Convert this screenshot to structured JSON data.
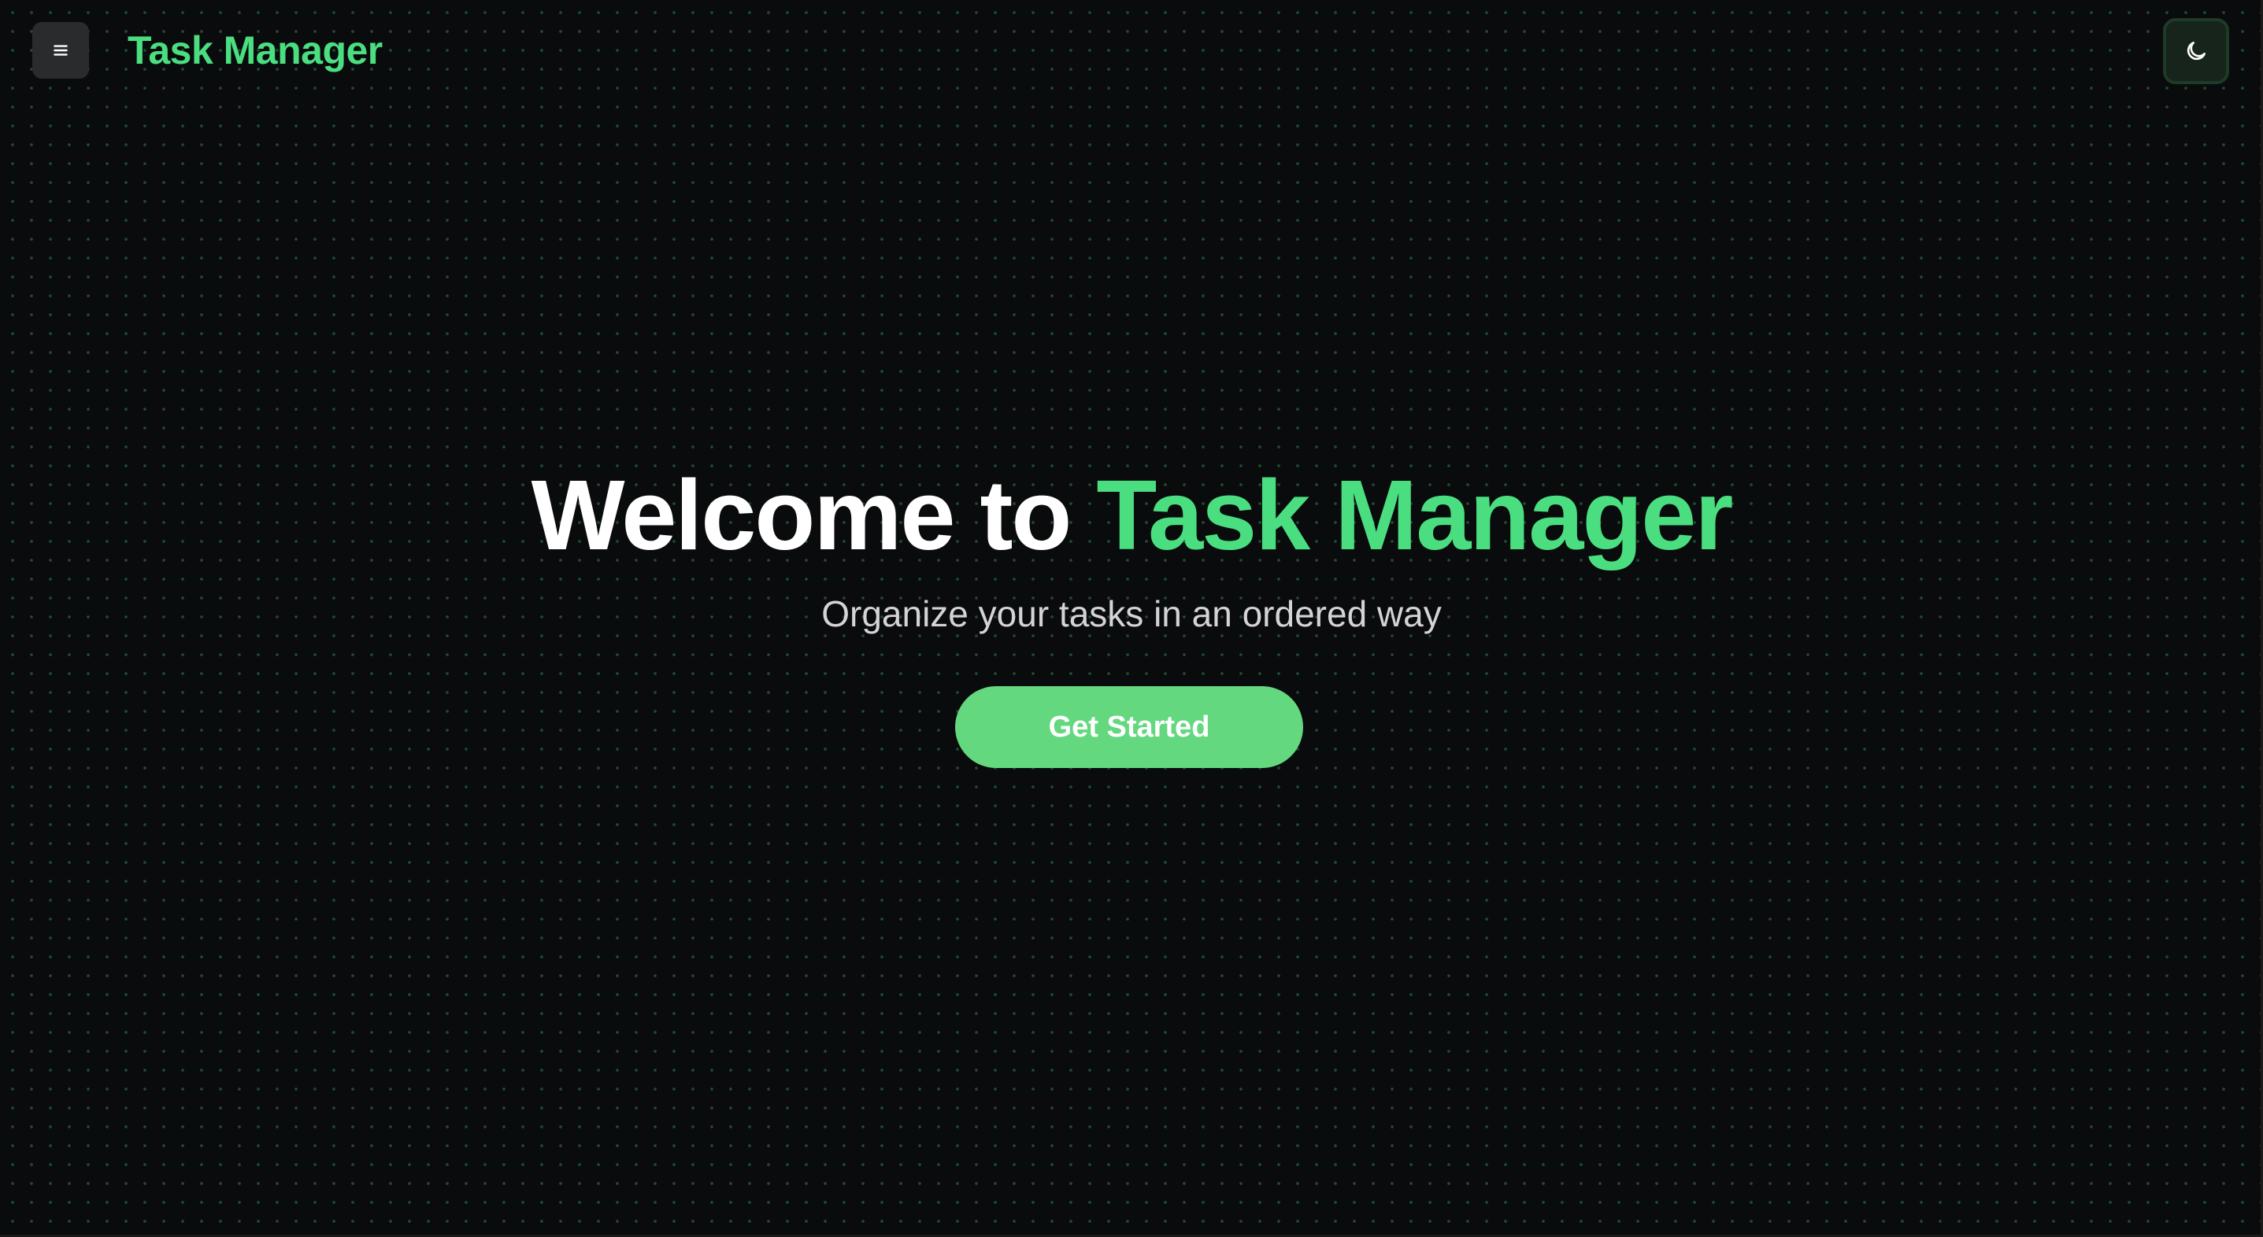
{
  "header": {
    "menu_icon": "hamburger-menu-icon",
    "brand": "Task Manager",
    "theme_icon": "moon-icon"
  },
  "hero": {
    "title_prefix": "Welcome to ",
    "title_highlight": "Task Manager",
    "subtitle": "Organize your tasks in an ordered way",
    "cta_label": "Get Started"
  },
  "colors": {
    "accent": "#4ade80",
    "background": "#0a0b0c",
    "button": "#63d87f",
    "text": "#ffffff",
    "subtitle": "#d4d4d8"
  }
}
